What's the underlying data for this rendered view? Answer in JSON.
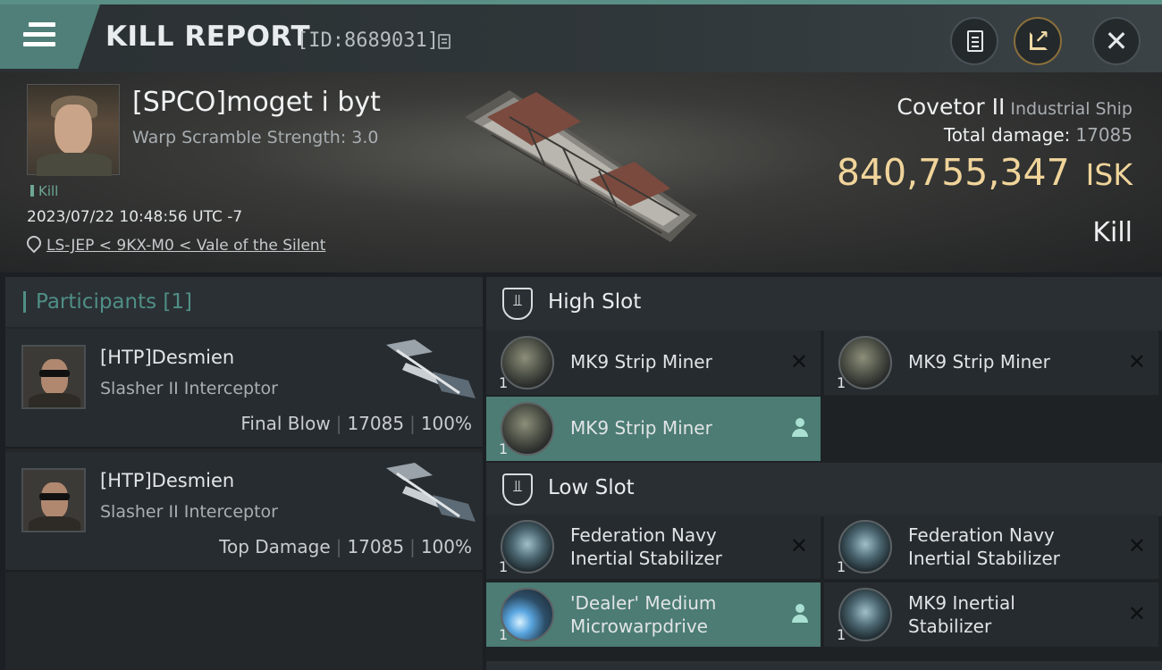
{
  "header": {
    "title": "KILL REPORT",
    "report_id": "[ID:8689031]",
    "icons": [
      "menu-icon",
      "copy-icon",
      "document-icon",
      "share-icon",
      "close-icon"
    ]
  },
  "victim": {
    "name": "[SPCO]moget i byt",
    "warp_scramble": "Warp Scramble Strength: 3.0",
    "tag": "Kill",
    "time": "2023/07/22 10:48:56 UTC -7",
    "location": "LS-JEP < 9KX-M0 < Vale of the Silent",
    "ship_name": "Covetor II",
    "ship_class": "Industrial Ship",
    "total_damage_label": "Total damage:",
    "total_damage": "17085",
    "isk_value": "840,755,347",
    "isk_unit": "ISK",
    "kill_label": "Kill"
  },
  "participants": {
    "title": "Participants [1]",
    "rows": [
      {
        "name": "[HTP]Desmien",
        "ship": "Slasher II Interceptor",
        "role": "Final Blow",
        "damage": "17085",
        "percent": "100%"
      },
      {
        "name": "[HTP]Desmien",
        "ship": "Slasher II Interceptor",
        "role": "Top Damage",
        "damage": "17085",
        "percent": "100%"
      }
    ]
  },
  "fittings": {
    "high_slot": {
      "title": "High Slot",
      "items": [
        {
          "name": "MK9 Strip Miner",
          "qty": "1",
          "icon": "strip-miner-icon"
        },
        {
          "name": "MK9 Strip Miner",
          "qty": "1",
          "icon": "strip-miner-icon"
        },
        {
          "name": "MK9 Strip Miner",
          "qty": "1",
          "icon": "strip-miner-icon"
        }
      ]
    },
    "low_slot": {
      "title": "Low Slot",
      "items": [
        {
          "name_line1": "Federation Navy",
          "name_line2": "Inertial Stabilizer",
          "qty": "1",
          "icon": "inertial-stabilizer-icon"
        },
        {
          "name_line1": "Federation Navy",
          "name_line2": "Inertial Stabilizer",
          "qty": "1",
          "icon": "inertial-stabilizer-icon"
        },
        {
          "name_line1": "'Dealer' Medium",
          "name_line2": "Microwarpdrive",
          "qty": "1",
          "icon": "microwarpdrive-icon"
        },
        {
          "name_line1": "MK9 Inertial",
          "name_line2": "Stabilizer",
          "qty": "1",
          "icon": "inertial-stabilizer-icon"
        }
      ]
    }
  },
  "colors": {
    "accent": "#4f7f78",
    "isk_gold": "#f0d49a",
    "highlight_row": "#4c7c74"
  }
}
